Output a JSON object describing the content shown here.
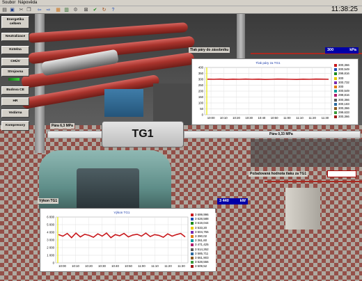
{
  "menu": {
    "items": [
      "Soubor",
      "Nápověda"
    ]
  },
  "toolbar": {
    "icons": [
      "print-icon",
      "save-icon",
      "cut-icon",
      "copy-icon",
      "back-arrow-icon",
      "forward-arrow-icon",
      "palette-icon",
      "grid-icon",
      "settings-icon",
      "close-window-icon",
      "check-icon",
      "refresh-icon",
      "help-icon"
    ]
  },
  "clock": "11:38:25",
  "nav": {
    "items": [
      {
        "label": "Energetika celkem"
      },
      {
        "label": "Neutralizace"
      },
      {
        "label": "Kotelna"
      },
      {
        "label": "CHÚV"
      },
      {
        "label": "Strojovna"
      },
      {
        "label": "Budova CE"
      },
      {
        "label": "HR"
      },
      {
        "label": "Vodárna"
      },
      {
        "label": "Kompresory"
      }
    ]
  },
  "pressure": {
    "label": "Tlak páry do zásobníku",
    "value": "300",
    "unit": "kPa"
  },
  "steam_left": {
    "label": "Pára 6,3 MPa"
  },
  "steam_right": {
    "label": "Pára 0,33 MPa"
  },
  "turbine": {
    "label": "TG1"
  },
  "setpoint": {
    "label": "Požadovaná hodnota tlaku za TG1",
    "value": ""
  },
  "power": {
    "label": "Výkon TG1",
    "value": "3 440",
    "unit": "kW"
  },
  "colors": {
    "series": "#c8181c",
    "marker": "#e6e600",
    "value_box": "#0000a8"
  },
  "chart_data": [
    {
      "type": "line",
      "title": "Tlak páry za TG1",
      "ylim": [
        0,
        400
      ],
      "yticks": [
        "400",
        "350",
        "300",
        "250",
        "200",
        "150",
        "100",
        "50",
        "0"
      ],
      "categories": [
        "10:00",
        "10:10",
        "10:20",
        "10:30",
        "10:40",
        "10:50",
        "11:00",
        "11:10",
        "11:20",
        "11:30"
      ],
      "series": [
        {
          "values": [
            301,
            300,
            302,
            299,
            301,
            300,
            302,
            300,
            301,
            299,
            300,
            302,
            301,
            300,
            299,
            301,
            300,
            302,
            301,
            300
          ]
        }
      ],
      "legend": [
        "300,366",
        "300,549",
        "299,816",
        "300",
        "300,732",
        "300",
        "300,549",
        "299,816",
        "300,366",
        "300,183",
        "300,366",
        "299,633",
        "300,366"
      ],
      "grid": true
    },
    {
      "type": "line",
      "title": "Výkon TG1",
      "ylim": [
        0,
        6000
      ],
      "yticks": [
        "6 000",
        "5 000",
        "4 000",
        "3 000",
        "2 000",
        "1 000",
        "0"
      ],
      "categories": [
        "10:00",
        "10:10",
        "10:20",
        "10:30",
        "10:40",
        "10:50",
        "11:00",
        "11:10",
        "11:20",
        "11:30"
      ],
      "series": [
        {
          "values": [
            3700,
            3500,
            3850,
            3300,
            3900,
            3400,
            3750,
            3600,
            3350,
            3800,
            3500,
            3900,
            3300,
            3700,
            3550,
            3850,
            3400,
            3650,
            3750,
            3500,
            3900,
            3450,
            3700,
            3600,
            3350,
            3800,
            3500,
            3700,
            3850,
            3400
          ]
        }
      ],
      "legend": [
        "3 699,996",
        "3 628,588",
        "3 619,044",
        "3 533,20",
        "3 504,755",
        "3 390,02",
        "3 361,60",
        "3 471,425",
        "3 514,262",
        "3 585,711",
        "3 661,903",
        "3 528,556",
        "3 509,52"
      ],
      "grid": true
    }
  ]
}
